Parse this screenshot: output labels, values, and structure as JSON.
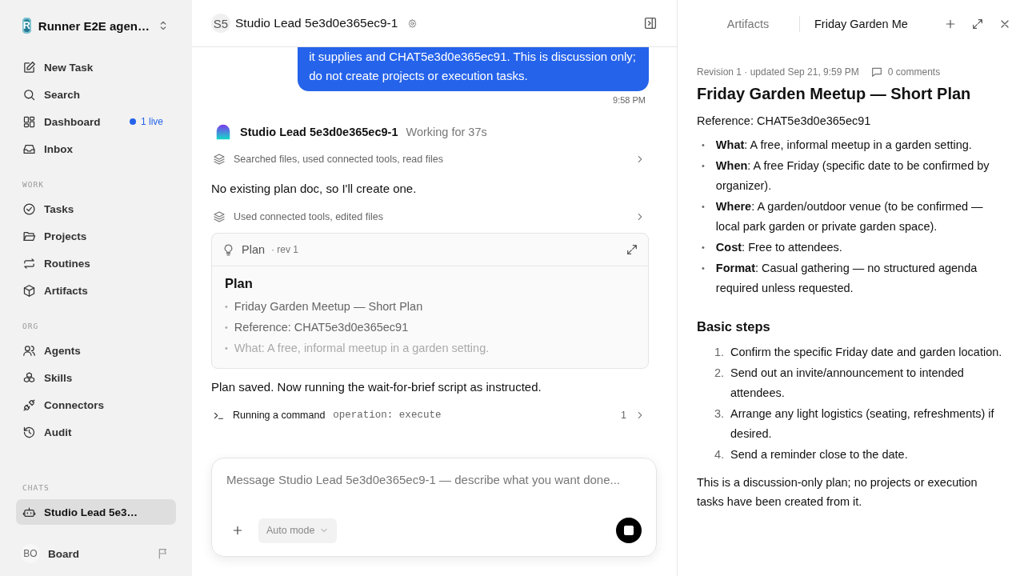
{
  "workspace": {
    "logo": "R",
    "name": "Runner E2E agen…"
  },
  "nav": [
    {
      "label": "New Task",
      "selected": false
    },
    {
      "label": "Search",
      "selected": false
    },
    {
      "label": "Dashboard",
      "selected": false,
      "badge": "1 live"
    },
    {
      "label": "Inbox",
      "selected": false
    }
  ],
  "sections": [
    {
      "heading": "WORK",
      "items": [
        {
          "label": "Tasks",
          "selected": false
        },
        {
          "label": "Projects",
          "selected": false
        },
        {
          "label": "Routines",
          "selected": false
        },
        {
          "label": "Artifacts",
          "selected": false
        }
      ]
    },
    {
      "heading": "ORG",
      "items": [
        {
          "label": "Agents",
          "selected": false
        },
        {
          "label": "Skills",
          "selected": false
        },
        {
          "label": "Connectors",
          "selected": false
        },
        {
          "label": "Audit",
          "selected": false
        }
      ]
    },
    {
      "heading": "CHATS",
      "items": [
        {
          "label": "Studio Lead 5e3…",
          "selected": true
        }
      ]
    }
  ],
  "user": {
    "initials": "BO",
    "name": "Board"
  },
  "chat": {
    "header": {
      "avatar": "S5",
      "title": "Studio Lead 5e3d0e365ec9-1"
    },
    "user_message": {
      "lines": [
        "it supplies and CHAT5e3d0e365ec91. This is discussion only;",
        "do not create projects or execution tasks."
      ],
      "time": "9:58 PM"
    },
    "agent": {
      "name": "Studio Lead 5e3d0e365ec9-1",
      "status": "Working for 37s"
    },
    "events": [
      {
        "kind": "activity",
        "text": "Searched files, used connected tools, read files"
      },
      {
        "kind": "text",
        "text": "No existing plan doc, so I'll create one."
      },
      {
        "kind": "activity",
        "text": "Used connected tools, edited files"
      },
      {
        "kind": "plan",
        "title": "Plan",
        "revision": "· rev 1",
        "heading": "Plan",
        "bullets": [
          {
            "marker": "•",
            "text": "Friday Garden Meetup — Short Plan"
          },
          {
            "marker": "•",
            "text": "Reference: CHAT5e3d0e365ec91"
          },
          {
            "marker": "•",
            "text": "What: A free, informal meetup in a garden setting."
          }
        ]
      },
      {
        "kind": "text",
        "text": "Plan saved. Now running the wait-for-brief script as instructed."
      },
      {
        "kind": "command",
        "label": "Running a command",
        "code": "operation: execute",
        "count": "1"
      }
    ],
    "composer": {
      "placeholder": "Message Studio Lead 5e3d0e365ec9-1 — describe what you want done...",
      "mode": "Auto mode"
    }
  },
  "artifact": {
    "tabs": [
      {
        "label": "Artifacts",
        "selected": false
      },
      {
        "label": "Friday Garden Me",
        "selected": true
      }
    ],
    "meta": "Revision 1 · updated Sep 21, 9:59 PM",
    "comments": "0 comments",
    "title": "Friday Garden Meetup — Short Plan",
    "reference": "Reference: CHAT5e3d0e365ec91",
    "bullets": [
      {
        "marker": "•",
        "text": "**What**: A free, informal meetup in a garden setting."
      },
      {
        "marker": "•",
        "text": "**When**: A free Friday (specific date to be confirmed by organizer)."
      },
      {
        "marker": "•",
        "text": "**Where**: A garden/outdoor venue (to be confirmed — local park garden or private garden space)."
      },
      {
        "marker": "•",
        "text": "**Cost**: Free to attendees."
      },
      {
        "marker": "•",
        "text": "**Format**: Casual gathering — no structured agenda required unless requested."
      }
    ],
    "steps_heading": "Basic steps",
    "steps": [
      {
        "number": "1.",
        "text": "Confirm the specific Friday date and garden location."
      },
      {
        "number": "2.",
        "text": "Send out an invite/announcement to intended attendees."
      },
      {
        "number": "3.",
        "text": "Arrange any light logistics (seating, refreshments) if desired."
      },
      {
        "number": "4.",
        "text": "Send a reminder close to the date."
      }
    ],
    "footer": "This is a discussion-only plan; no projects or execution tasks have been created from it."
  }
}
